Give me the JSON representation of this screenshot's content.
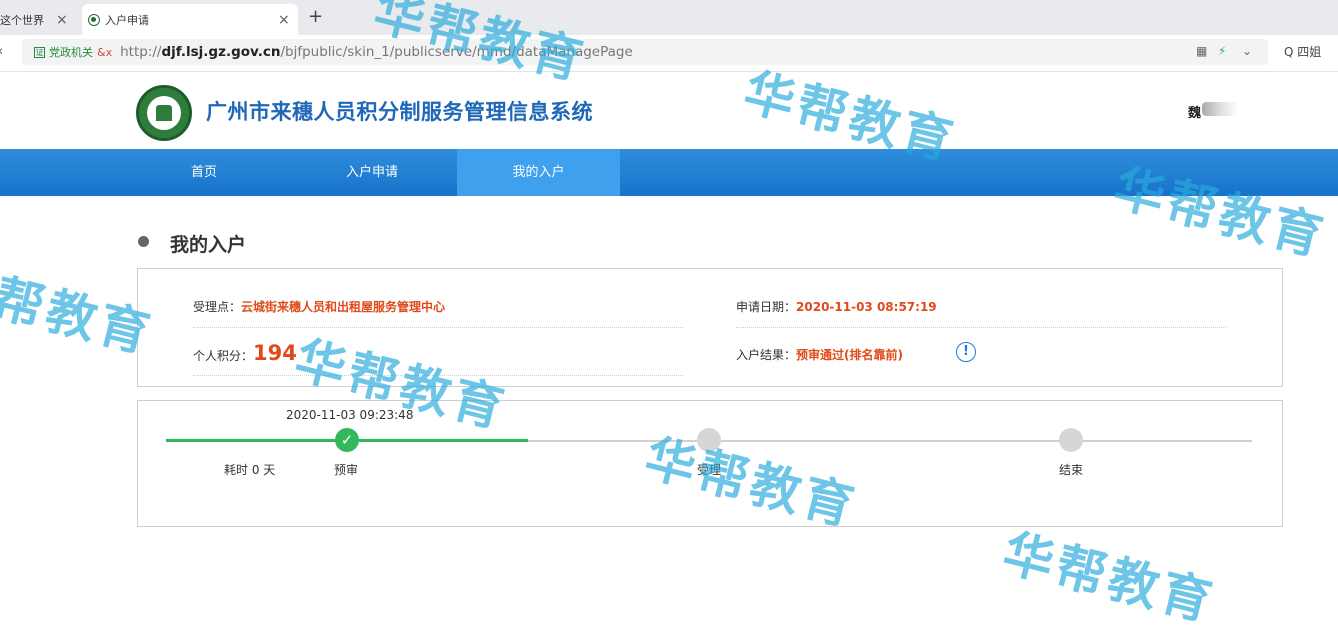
{
  "browser": {
    "tabs": [
      {
        "label": "这个世界",
        "close": "×"
      },
      {
        "label": "入户申请",
        "close": "×"
      }
    ],
    "new_tab": "+",
    "cert_badge": "证",
    "cert_label": "党政机关",
    "insecure_label": "&x",
    "url_prefix": "http://",
    "url_host": "djf.lsj.gz.gov.cn",
    "url_path": "/bjfpublic/skin_1/publicserve/mmd/dataManagePage",
    "search_label": "Q 四姐"
  },
  "header": {
    "site_title": "广州市来穗人员积分制服务管理信息系统",
    "user_name": "魏"
  },
  "nav": {
    "items": [
      "首页",
      "入户申请",
      "我的入户"
    ],
    "active_index": 2
  },
  "main": {
    "section_title": "我的入户",
    "info": {
      "office_label": "受理点：",
      "office_value": "云城街来穗人员和出租屋服务管理中心",
      "date_label": "申请日期：",
      "date_value": "2020-11-03 08:57:19",
      "score_label": "个人积分：",
      "score_value": "194",
      "result_label": "入户结果：",
      "result_value": "预审通过(排名靠前)",
      "result_icon": "!"
    },
    "progress": {
      "timestamp": "2020-11-03 09:23:48",
      "elapsed": "耗时 0 天",
      "check_icon": "✓",
      "steps": [
        {
          "label": "预审",
          "done": true
        },
        {
          "label": "受理",
          "done": false
        },
        {
          "label": "结束",
          "done": false
        }
      ]
    }
  },
  "watermark": "华帮教育",
  "colors": {
    "nav": "#1773c9",
    "nav_active": "#3fa1ee",
    "title_blue": "#1f68b8",
    "accent_red": "#e04a1a",
    "progress_green": "#2fb85a",
    "watermark": "#28aadc"
  }
}
